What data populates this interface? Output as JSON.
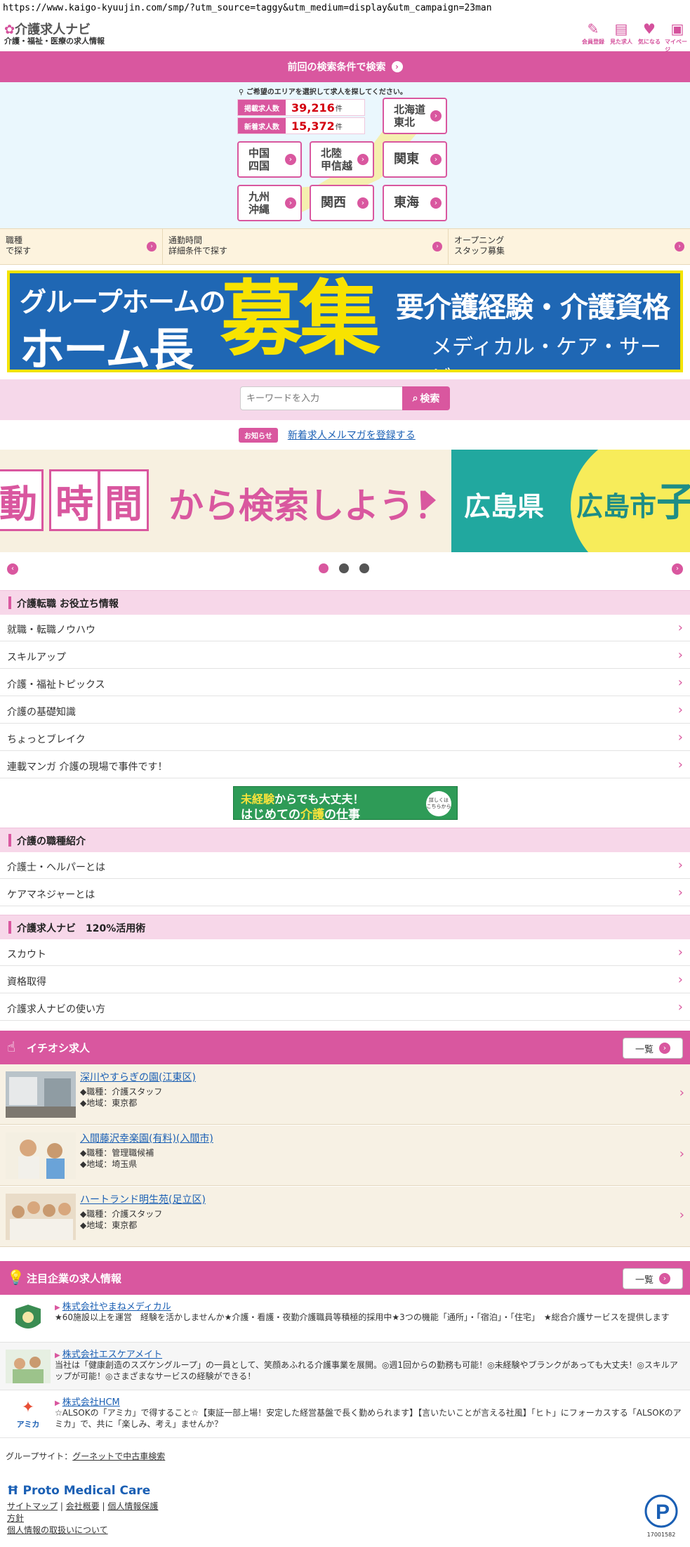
{
  "url": "https://www.kaigo-kyuujin.com/smp/?utm_source=taggy&utm_medium=display&utm_campaign=23man",
  "header": {
    "logo": "介護求人ナビ",
    "tagline": "介護・福祉・医療の求人情報",
    "icons": [
      {
        "label": "会員登録",
        "glyph": "✎"
      },
      {
        "label": "見た求人",
        "glyph": "▤"
      },
      {
        "label": "気になる",
        "glyph": "♥"
      },
      {
        "label": "マイページ",
        "glyph": "▣"
      }
    ]
  },
  "prev_search": {
    "label": "前回の検索条件で検索"
  },
  "area": {
    "prompt": "ご希望のエリアを選択して求人を探してください。",
    "stats": [
      {
        "label": "掲載求人数",
        "value": "39,216",
        "unit": "件"
      },
      {
        "label": "新着求人数",
        "value": "15,372",
        "unit": "件"
      }
    ],
    "buttons": [
      "北海道\n東北",
      "中国\n四国",
      "北陸\n甲信越",
      "関東",
      "九州\n沖縄",
      "関西",
      "東海"
    ]
  },
  "categories": [
    "職種\nで探す",
    "通勤時間\n詳細条件で探す",
    "オープニング\nスタッフ募集"
  ],
  "banner": {
    "line1": "グループホームの",
    "line2": "ホーム長",
    "big": "募集",
    "right1": "要介護経験・介護資格",
    "right2": "メディカル・ケア・サービス"
  },
  "search": {
    "placeholder": "キーワードを入力",
    "button": "検索"
  },
  "notice": {
    "badge": "お知らせ",
    "link": "新着求人メルマガを登録する"
  },
  "slider": {
    "boxes": [
      "動",
      "時",
      "間"
    ],
    "text": "から検索しよう！",
    "prefecture": "広島県",
    "city": "広島市",
    "city_char": "子"
  },
  "sections": {
    "tips": {
      "title": "介護転職 お役立ち情報",
      "items": [
        "就職・転職ノウハウ",
        "スキルアップ",
        "介護・福祉トピックス",
        "介護の基礎知識",
        "ちょっとブレイク",
        "連載マンガ 介護の現場で事件です！"
      ]
    },
    "midbanner": {
      "l1a": "未経験",
      "l1b": "からでも大丈夫！",
      "l2a": "はじめての",
      "l2b": "介護",
      "l2c": "の仕事",
      "badge": "詳しくは こちらから"
    },
    "jobs_intro": {
      "title": "介護の職種紹介",
      "items": [
        "介護士・ヘルパーとは",
        "ケアマネジャーとは"
      ]
    },
    "usage": {
      "title": "介護求人ナビ　120%活用術",
      "items": [
        "スカウト",
        "資格取得",
        "介護求人ナビの使い方"
      ]
    }
  },
  "pickup": {
    "title": "イチオシ求人",
    "more": "一覧",
    "jobs": [
      {
        "title": "深川やすらぎの園(江東区)",
        "role": "◆職種：介護スタッフ",
        "area": "◆地域：東京都"
      },
      {
        "title": "入間藤沢幸楽園(有料)(入間市)",
        "role": "◆職種：管理職候補",
        "area": "◆地域：埼玉県"
      },
      {
        "title": "ハートランド明生苑(足立区)",
        "role": "◆職種：介護スタッフ",
        "area": "◆地域：東京都"
      }
    ]
  },
  "featured": {
    "title": "注目企業の求人情報",
    "more": "一覧",
    "companies": [
      {
        "name": "株式会社やまねメディカル",
        "desc": "★60施設以上を運営　経験を活かしませんか★介護・看護・夜勤介護職員等積極的採用中★3つの機能「通所」・「宿泊」・「住宅」　★総合介護サービスを提供します"
      },
      {
        "name": "株式会社エスケアメイト",
        "desc": "当社は「健康創造のスズケングループ」の一員として、笑顔あふれる介護事業を展開。◎週1回からの勤務も可能！◎未経験やブランクがあっても大丈夫！◎スキルアップが可能！◎さまざまなサービスの経験ができる！"
      },
      {
        "name": "株式会社HCM",
        "desc": "☆ALSOKの「アミカ」で得すること☆【東証一部上場！安定した経営基盤で長く勤められます】【言いたいことが言える社風】「ヒト」にフォーカスする「ALSOKのアミカ」で、共に「楽しみ、考え」ませんか？",
        "logo_text": "アミカ"
      }
    ]
  },
  "footer": {
    "group_label": "グループサイト：",
    "group_link": "グーネットで中古車検索",
    "brand": "Proto Medical Care",
    "links_row1": [
      "サイトマップ",
      "会社概要",
      "個人情報保護"
    ],
    "link_policy": "方針",
    "link_privacy": "個人情報の取扱いについて",
    "pmark_number": "17001582"
  },
  "colors": {
    "accent": "#d9579f",
    "banner_blue": "#1f67b4",
    "banner_yellow": "#f3e300",
    "link": "#1a5fb4"
  }
}
